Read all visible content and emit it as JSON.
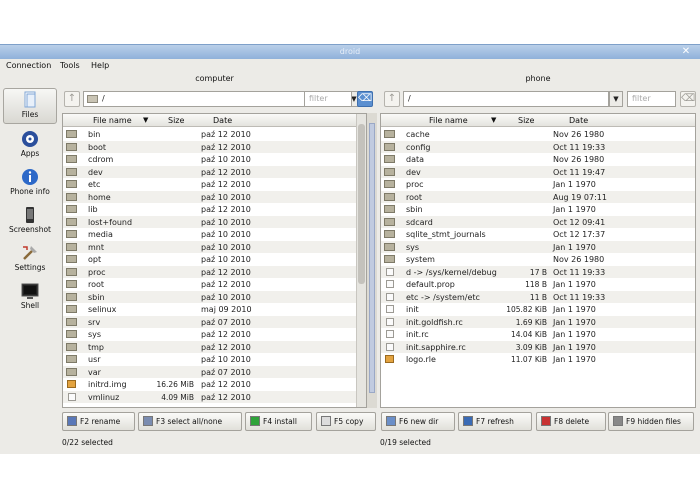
{
  "window": {
    "title": "droid"
  },
  "menu": [
    "Connection",
    "Tools",
    "Help"
  ],
  "sidebar": [
    {
      "label": "Files",
      "icon": "files-icon"
    },
    {
      "label": "Apps",
      "icon": "apps-icon"
    },
    {
      "label": "Phone info",
      "icon": "info-icon"
    },
    {
      "label": "Screenshot",
      "icon": "phone-icon"
    },
    {
      "label": "Settings",
      "icon": "settings-icon"
    },
    {
      "label": "Shell",
      "icon": "terminal-icon"
    }
  ],
  "left": {
    "title": "computer",
    "path": "/",
    "filter_placeholder": "filter",
    "columns": [
      "File name",
      "Size",
      "Date"
    ],
    "rows": [
      {
        "name": "bin",
        "size": "",
        "date": "paź 12 2010",
        "type": "folder"
      },
      {
        "name": "boot",
        "size": "",
        "date": "paź 12 2010",
        "type": "folder"
      },
      {
        "name": "cdrom",
        "size": "",
        "date": "paź 10 2010",
        "type": "folder"
      },
      {
        "name": "dev",
        "size": "",
        "date": "paź 12 2010",
        "type": "folder"
      },
      {
        "name": "etc",
        "size": "",
        "date": "paź 12 2010",
        "type": "folder"
      },
      {
        "name": "home",
        "size": "",
        "date": "paź 10 2010",
        "type": "folder"
      },
      {
        "name": "lib",
        "size": "",
        "date": "paź 12 2010",
        "type": "folder"
      },
      {
        "name": "lost+found",
        "size": "",
        "date": "paź 10 2010",
        "type": "folder"
      },
      {
        "name": "media",
        "size": "",
        "date": "paź 10 2010",
        "type": "folder"
      },
      {
        "name": "mnt",
        "size": "",
        "date": "paź 10 2010",
        "type": "folder"
      },
      {
        "name": "opt",
        "size": "",
        "date": "paź 10 2010",
        "type": "folder"
      },
      {
        "name": "proc",
        "size": "",
        "date": "paź 12 2010",
        "type": "folder"
      },
      {
        "name": "root",
        "size": "",
        "date": "paź 12 2010",
        "type": "folder"
      },
      {
        "name": "sbin",
        "size": "",
        "date": "paź 10 2010",
        "type": "folder"
      },
      {
        "name": "selinux",
        "size": "",
        "date": "maj 09 2010",
        "type": "folder"
      },
      {
        "name": "srv",
        "size": "",
        "date": "paź 07 2010",
        "type": "folder"
      },
      {
        "name": "sys",
        "size": "",
        "date": "paź 12 2010",
        "type": "folder"
      },
      {
        "name": "tmp",
        "size": "",
        "date": "paź 12 2010",
        "type": "folder"
      },
      {
        "name": "usr",
        "size": "",
        "date": "paź 10 2010",
        "type": "folder"
      },
      {
        "name": "var",
        "size": "",
        "date": "paź 07 2010",
        "type": "folder"
      },
      {
        "name": "initrd.img",
        "size": "16.26 MiB",
        "date": "paź 12 2010",
        "type": "image"
      },
      {
        "name": "vmlinuz",
        "size": "4.09 MiB",
        "date": "paź 12 2010",
        "type": "file"
      }
    ],
    "status": "0/22 selected"
  },
  "right": {
    "title": "phone",
    "path": "/",
    "filter_placeholder": "filter",
    "columns": [
      "File name",
      "Size",
      "Date"
    ],
    "rows": [
      {
        "name": "cache",
        "size": "",
        "date": "Nov 26 1980",
        "type": "folder"
      },
      {
        "name": "config",
        "size": "",
        "date": "Oct 11 19:33",
        "type": "folder"
      },
      {
        "name": "data",
        "size": "",
        "date": "Nov 26 1980",
        "type": "folder"
      },
      {
        "name": "dev",
        "size": "",
        "date": "Oct 11 19:47",
        "type": "folder"
      },
      {
        "name": "proc",
        "size": "",
        "date": "Jan 1 1970",
        "type": "folder"
      },
      {
        "name": "root",
        "size": "",
        "date": "Aug 19 07:11",
        "type": "folder"
      },
      {
        "name": "sbin",
        "size": "",
        "date": "Jan 1 1970",
        "type": "folder"
      },
      {
        "name": "sdcard",
        "size": "",
        "date": "Oct 12 09:41",
        "type": "folder"
      },
      {
        "name": "sqlite_stmt_journals",
        "size": "",
        "date": "Oct 12 17:37",
        "type": "folder"
      },
      {
        "name": "sys",
        "size": "",
        "date": "Jan 1 1970",
        "type": "folder"
      },
      {
        "name": "system",
        "size": "",
        "date": "Nov 26 1980",
        "type": "folder"
      },
      {
        "name": "d -> /sys/kernel/debug",
        "size": "17 B",
        "date": "Oct 11 19:33",
        "type": "file"
      },
      {
        "name": "default.prop",
        "size": "118 B",
        "date": "Jan 1 1970",
        "type": "file"
      },
      {
        "name": "etc -> /system/etc",
        "size": "11 B",
        "date": "Oct 11 19:33",
        "type": "file"
      },
      {
        "name": "init",
        "size": "105.82 KiB",
        "date": "Jan 1 1970",
        "type": "file"
      },
      {
        "name": "init.goldfish.rc",
        "size": "1.69 KiB",
        "date": "Jan 1 1970",
        "type": "file"
      },
      {
        "name": "init.rc",
        "size": "14.04 KiB",
        "date": "Jan 1 1970",
        "type": "file"
      },
      {
        "name": "init.sapphire.rc",
        "size": "3.09 KiB",
        "date": "Jan 1 1970",
        "type": "file"
      },
      {
        "name": "logo.rle",
        "size": "11.07 KiB",
        "date": "Jan 1 1970",
        "type": "image"
      }
    ],
    "status": "0/19 selected"
  },
  "buttons": {
    "left": [
      {
        "label": "F2 rename",
        "icon": "rename-icon"
      },
      {
        "label": "F3 select all/none",
        "icon": "select-icon"
      },
      {
        "label": "F4 install",
        "icon": "install-icon"
      },
      {
        "label": "F5 copy",
        "icon": "copy-icon"
      }
    ],
    "right": [
      {
        "label": "F6 new dir",
        "icon": "new-dir-icon"
      },
      {
        "label": "F7 refresh",
        "icon": "refresh-icon"
      },
      {
        "label": "F8 delete",
        "icon": "delete-icon"
      },
      {
        "label": "F9 hidden files",
        "icon": "hidden-files-icon"
      }
    ]
  }
}
